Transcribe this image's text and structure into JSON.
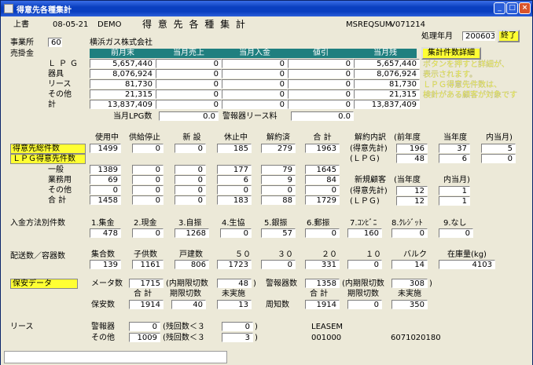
{
  "window": {
    "title": "得意先各種集計"
  },
  "header": {
    "mode": "上書",
    "date": "08-05-21",
    "user": "DEMO",
    "title": "得 意 先 各 種 集 計",
    "program": "MSREQSUM",
    "version": "V071214",
    "period_label": "処理年月",
    "period": "200603",
    "end_button": "終了"
  },
  "office": {
    "label": "事業所",
    "code": "60",
    "name": "横浜ガス株式会社"
  },
  "receivables": {
    "label": "売掛金",
    "columns": [
      "前月末",
      "当月売上",
      "当月入金",
      "値引",
      "当月残"
    ],
    "detail_button": "集計件数詳細",
    "rows": [
      {
        "label": "ＬＰＧ",
        "values": [
          "5,657,440",
          "0",
          "0",
          "0",
          "5,657,440"
        ]
      },
      {
        "label": "器具",
        "values": [
          "8,076,924",
          "0",
          "0",
          "0",
          "8,076,924"
        ]
      },
      {
        "label": "リース",
        "values": [
          "81,730",
          "0",
          "0",
          "0",
          "81,730"
        ]
      },
      {
        "label": "その他",
        "values": [
          "21,315",
          "0",
          "0",
          "0",
          "21,315"
        ]
      },
      {
        "label": "計",
        "values": [
          "13,837,409",
          "0",
          "0",
          "0",
          "13,837,409"
        ]
      }
    ],
    "lpg_label": "当月LPG数",
    "lpg_value": "0.0",
    "lease_label": "警報器リース料",
    "lease_value": "0.0"
  },
  "notes": [
    "ボタンを押すと詳細が、",
    "表示されます。",
    "ＬＰＧ得意先件数は、",
    "検針がある顧客が対象です"
  ],
  "customers": {
    "columns": [
      "使用中",
      "供給停止",
      "新 設",
      "休止中",
      "解約済",
      "合 計"
    ],
    "total_label": "得意先総件数",
    "lpg_label": "ＬＰＧ得意先件数",
    "total_values": [
      "1499",
      "0",
      "0",
      "185",
      "279",
      "1963"
    ],
    "sub_rows": [
      {
        "label": "一般",
        "values": [
          "1389",
          "0",
          "0",
          "177",
          "79",
          "1645"
        ]
      },
      {
        "label": "業務用",
        "values": [
          "69",
          "0",
          "0",
          "6",
          "9",
          "84"
        ]
      },
      {
        "label": "その他",
        "values": [
          "0",
          "0",
          "0",
          "0",
          "0",
          "0"
        ]
      },
      {
        "label": "合 計",
        "values": [
          "1458",
          "0",
          "0",
          "183",
          "88",
          "1729"
        ]
      }
    ],
    "cancel": {
      "title": "解約内訳",
      "cols": [
        "(前年度",
        "当年度",
        "内当月)"
      ],
      "row1_label": "(得意先計)",
      "row1": [
        "196",
        "37",
        "5"
      ],
      "row2_label": "(ＬＰＧ)",
      "row2": [
        "48",
        "6",
        "0"
      ]
    },
    "new": {
      "title": "新規顧客",
      "cols": [
        "(当年度",
        "内当月)"
      ],
      "row1_label": "(得意先計)",
      "row1": [
        "12",
        "1"
      ],
      "row2_label": "(ＬＰＧ)",
      "row2": [
        "12",
        "1"
      ]
    }
  },
  "payment": {
    "label": "入金方法別件数",
    "cols": [
      "1.集金",
      "2.現金",
      "3.自振",
      "4.生協",
      "5.銀振",
      "6.郵振",
      "7.ｺﾝﾋﾞﾆ",
      "8.ｸﾚｼﾞｯﾄ",
      "9.なし"
    ],
    "values": [
      "478",
      "0",
      "1268",
      "0",
      "57",
      "0",
      "160",
      "0",
      "0"
    ]
  },
  "delivery": {
    "label": "配送数／容器数",
    "cols": [
      "集合数",
      "子供数",
      "戸建数",
      "５０",
      "３０",
      "２０",
      "１０",
      "バルク",
      "在庫量(kg)"
    ],
    "values": [
      "139",
      "1161",
      "806",
      "1723",
      "0",
      "331",
      "0",
      "14",
      "4103"
    ]
  },
  "safety": {
    "label": "保安データ",
    "meter_label": "メータ数",
    "meter_value": "1715",
    "meter_exp_label": "(内期限切数",
    "meter_exp_value": "48",
    "alarm_label": "警報器数",
    "alarm_value": "1358",
    "alarm_exp_label": "(内期限切数",
    "alarm_exp_value": "308",
    "cols_left": [
      "合 計",
      "期限切数",
      "未実施"
    ],
    "cols_right": [
      "合 計",
      "期限切数",
      "未実施"
    ],
    "hoan_label": "保安数",
    "hoan_values": [
      "1914",
      "40",
      "13"
    ],
    "shuchi_label": "周知数",
    "shuchi_values": [
      "1914",
      "0",
      "350"
    ]
  },
  "lease": {
    "label": "リース",
    "alarm_label": "警報器",
    "alarm_value": "0",
    "alarm_rem_label": "(残回数＜３",
    "alarm_rem_value": "0",
    "other_label": "その他",
    "other_value": "1009",
    "other_rem_label": "(残回数＜３",
    "other_rem_value": "3",
    "code_label": "LEASEM",
    "code_value": "001000",
    "code_ref": "6071020180"
  }
}
